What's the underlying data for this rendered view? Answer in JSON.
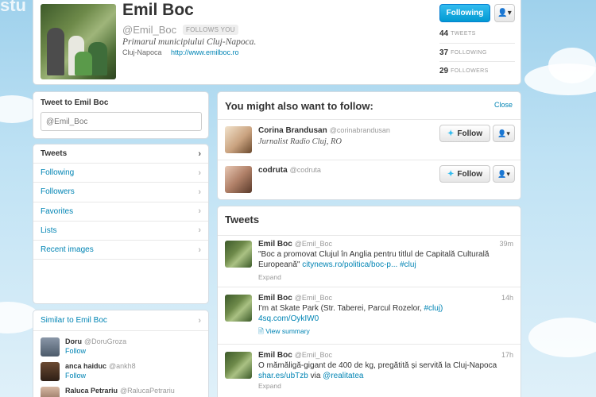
{
  "background_text": "stu",
  "profile": {
    "name": "Emil Boc",
    "handle": "@Emil_Boc",
    "follows_you": "FOLLOWS YOU",
    "bio": "Primarul municipiului Cluj-Napoca.",
    "location": "Cluj-Napoca",
    "website": "http://www.emilboc.ro",
    "following_button": "Following",
    "stats": [
      {
        "value": "44",
        "label": "TWEETS"
      },
      {
        "value": "37",
        "label": "FOLLOWING"
      },
      {
        "value": "29",
        "label": "FOLLOWERS"
      }
    ]
  },
  "tweet_to": {
    "title": "Tweet to Emil Boc",
    "placeholder": "@Emil_Boc"
  },
  "nav": {
    "items": [
      {
        "label": "Tweets"
      },
      {
        "label": "Following"
      },
      {
        "label": "Followers"
      },
      {
        "label": "Favorites"
      },
      {
        "label": "Lists"
      },
      {
        "label": "Recent images"
      }
    ]
  },
  "similar": {
    "title": "Similar to Emil Boc",
    "items": [
      {
        "name": "Doru",
        "handle": "@DoruGroza",
        "follow": "Follow"
      },
      {
        "name": "anca haiduc",
        "handle": "@ankh8",
        "follow": "Follow"
      },
      {
        "name": "Raluca Petrariu",
        "handle": "@RalucaPetrariu",
        "follow": ""
      }
    ]
  },
  "who_to_follow": {
    "title": "You might also want to follow:",
    "close": "Close",
    "items": [
      {
        "name": "Corina Brandusan",
        "handle": "@corinabrandusan",
        "description": "Jurnalist Radio Cluj, RO",
        "follow": "Follow"
      },
      {
        "name": "codruta",
        "handle": "@codruta",
        "description": "",
        "follow": "Follow"
      }
    ]
  },
  "tweets": {
    "title": "Tweets",
    "items": [
      {
        "name": "Emil Boc",
        "handle": "@Emil_Boc",
        "time": "39m",
        "text": "\"Boc a promovat Clujul în Anglia pentru titlul de Capitală Culturală Europeană\"",
        "link": "citynews.ro/politica/boc-p...",
        "hashtag": "#cluj",
        "action": "Expand"
      },
      {
        "name": "Emil Boc",
        "handle": "@Emil_Boc",
        "time": "14h",
        "text": "I'm at Skate Park (Str. Taberei, Parcul Rozelor,",
        "hashtag": "#cluj)",
        "link": "4sq.com/OykIW0",
        "action": "View summary"
      },
      {
        "name": "Emil Boc",
        "handle": "@Emil_Boc",
        "time": "17h",
        "text": "O mămăligă-gigant de 400 de kg, pregătită și servită la Cluj-Napoca",
        "link": "shar.es/ubTzb",
        "via": "via",
        "mention": "@realitatea",
        "action": "Expand"
      }
    ]
  }
}
